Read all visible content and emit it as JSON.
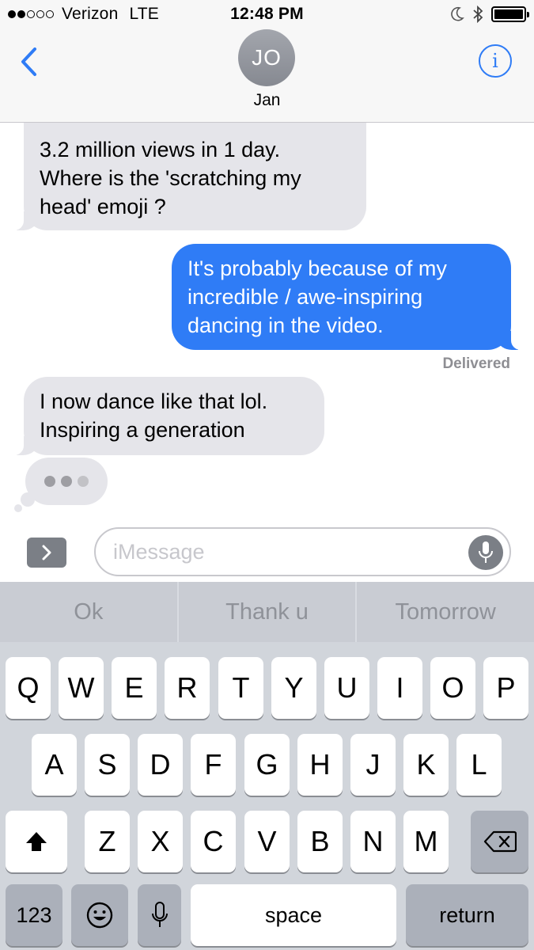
{
  "status_bar": {
    "carrier": "Verizon",
    "network": "LTE",
    "signal_bars_filled": 2,
    "signal_bars_total": 5,
    "time": "12:48 PM",
    "battery_level": 1.0
  },
  "header": {
    "avatar_initials": "JO",
    "contact_name": "Jan",
    "info_glyph": "i",
    "back_icon": "chevron-left-icon"
  },
  "messages": [
    {
      "direction": "incoming",
      "text": "3.2 million views in 1 day.\nWhere is the 'scratching my\nhead' emoji ?"
    },
    {
      "direction": "outgoing",
      "text": "It's probably because of my\nincredible / awe-inspiring\ndancing in the video."
    },
    {
      "direction": "incoming",
      "text": "I now dance like that lol.\nInspiring a generation"
    }
  ],
  "delivered_label": "Delivered",
  "typing_indicator": true,
  "input": {
    "placeholder": "iMessage",
    "value": ""
  },
  "keyboard": {
    "suggestions": [
      "Ok",
      "Thank u",
      "Tomorrow"
    ],
    "row1": [
      "Q",
      "W",
      "E",
      "R",
      "T",
      "Y",
      "U",
      "I",
      "O",
      "P"
    ],
    "row2": [
      "A",
      "S",
      "D",
      "F",
      "G",
      "H",
      "J",
      "K",
      "L"
    ],
    "row3": [
      "Z",
      "X",
      "C",
      "V",
      "B",
      "N",
      "M"
    ],
    "numbers_label": "123",
    "space_label": "space",
    "return_label": "return"
  },
  "colors": {
    "accent": "#2f7cf6",
    "incoming_bubble": "#e5e5ea",
    "keyboard_bg": "#d1d5db"
  }
}
